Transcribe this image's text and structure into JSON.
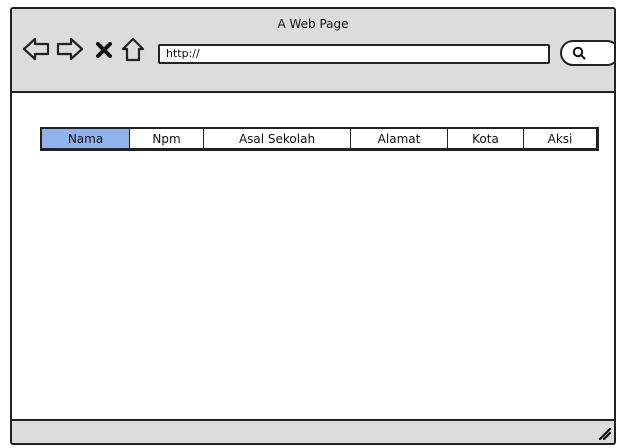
{
  "window": {
    "title": "A Web Page"
  },
  "nav": {
    "back_icon": "back-arrow-icon",
    "forward_icon": "forward-arrow-icon",
    "stop_icon": "close-icon",
    "home_icon": "home-icon"
  },
  "address_bar": {
    "value": "http://"
  },
  "search": {
    "icon": "search-icon"
  },
  "table": {
    "columns": [
      "Nama",
      "Npm",
      "Asal Sekolah",
      "Alamat",
      "Kota",
      "Aksi"
    ],
    "selected_column": "Nama"
  },
  "colors": {
    "selected_header": "#8fb3ea",
    "chrome": "#dcdcdc"
  }
}
